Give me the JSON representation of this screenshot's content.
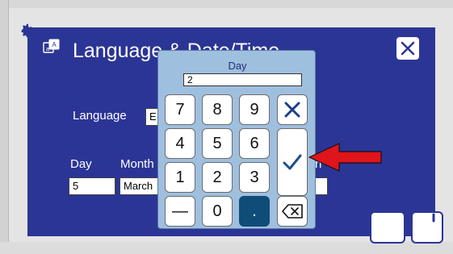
{
  "dialog": {
    "title": "Language & Date/Time",
    "language_label": "Language",
    "language_value": "E",
    "day_label": "Day",
    "month_label": "Month",
    "day_value": "5",
    "month_value": "March",
    "hidden_label_fragment": "n"
  },
  "keypad": {
    "title": "Day",
    "display_value": "2",
    "keys": {
      "k7": "7",
      "k8": "8",
      "k9": "9",
      "k4": "4",
      "k5": "5",
      "k6": "6",
      "k1": "1",
      "k2": "2",
      "k3": "3",
      "k0": "0",
      "dot": ".",
      "minus": "—"
    }
  },
  "colors": {
    "dialog_bg": "#2b3595",
    "keypad_bg": "#9fbfdf",
    "accent": "#0f4d78",
    "arrow": "#e0141b"
  },
  "icons": {
    "close": "close-icon",
    "confirm": "check-icon",
    "cancel": "cancel-x-icon",
    "backspace": "backspace-icon",
    "settings": "gear-icon",
    "language": "language-icon"
  }
}
